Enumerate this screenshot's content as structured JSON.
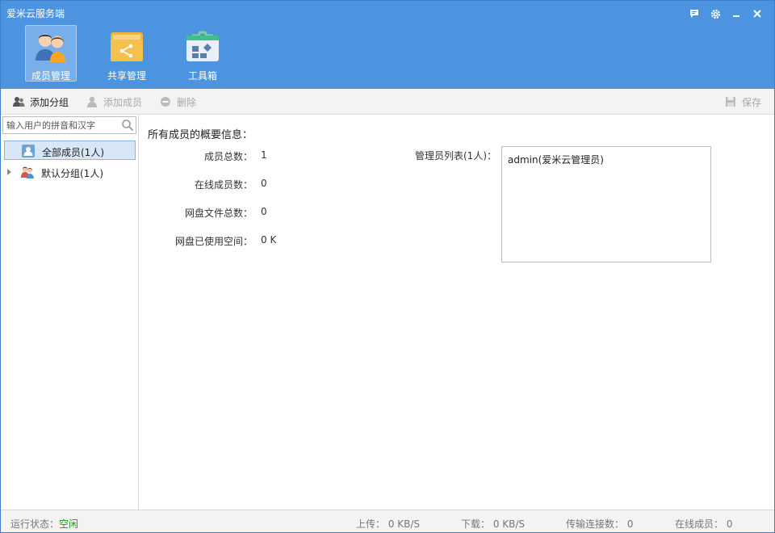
{
  "window": {
    "title": "爱米云服务端"
  },
  "nav": {
    "items": [
      {
        "label": "成员管理",
        "active": true,
        "icon": "members-icon"
      },
      {
        "label": "共享管理",
        "active": false,
        "icon": "share-folder-icon"
      },
      {
        "label": "工具箱",
        "active": false,
        "icon": "toolbox-icon"
      }
    ]
  },
  "toolbar": {
    "add_group": "添加分组",
    "add_member": "添加成员",
    "delete": "删除",
    "save": "保存"
  },
  "sidebar": {
    "search_placeholder": "输入用户的拼音和汉字",
    "tree": [
      {
        "label": "全部成员(1人)",
        "selected": true,
        "icon": "all-members-icon"
      },
      {
        "label": "默认分组(1人)",
        "selected": false,
        "icon": "group-icon"
      }
    ]
  },
  "main": {
    "summary_title": "所有成员的概要信息：",
    "stats": [
      {
        "label": "成员总数：",
        "value": "1"
      },
      {
        "label": "在线成员数：",
        "value": "0"
      },
      {
        "label": "网盘文件总数：",
        "value": "0"
      },
      {
        "label": "网盘已使用空间：",
        "value": "0 K"
      }
    ],
    "admin_list_label": "管理员列表(1人)：",
    "admins": [
      "admin(爱米云管理员)"
    ]
  },
  "status": {
    "run_state_label": "运行状态：",
    "run_state_value": "空闲",
    "upload": "上传： 0 KB/S",
    "download": "下载： 0 KB/S",
    "connections": "传输连接数： 0",
    "online_members": "在线成员： 0"
  },
  "colors": {
    "header_bg": "#4d94e0",
    "status_ok": "#1a9a1a"
  }
}
